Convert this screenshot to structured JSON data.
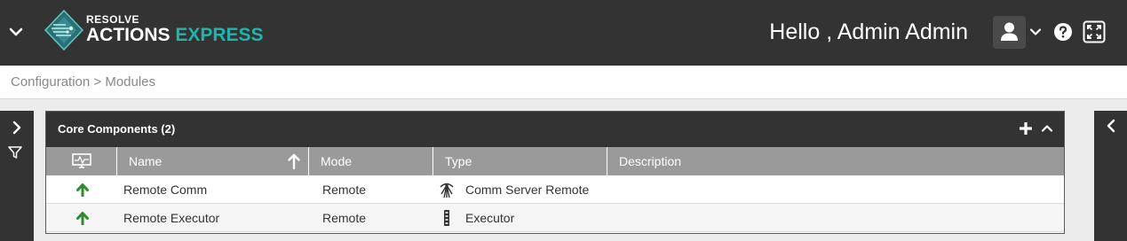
{
  "header": {
    "logo_top": "RESOLVE",
    "logo_word1": "ACTIONS",
    "logo_word2": "EXPRESS",
    "greeting": "Hello , Admin Admin",
    "icons": [
      "chevron-down-icon",
      "user-icon",
      "help-icon",
      "fullscreen-icon"
    ]
  },
  "breadcrumb": "Configuration > Modules",
  "panel": {
    "title": "Core Components (2)",
    "columns": [
      "Name",
      "Mode",
      "Type",
      "Description"
    ],
    "rows": [
      {
        "status": "up-arrow-icon",
        "name": "Remote Comm",
        "mode": "Remote",
        "type_icon": "antenna-icon",
        "type": "Comm Server Remote",
        "description": ""
      },
      {
        "status": "up-arrow-icon",
        "name": "Remote Executor",
        "mode": "Remote",
        "type_icon": "executor-icon",
        "type": "Executor",
        "description": ""
      }
    ]
  },
  "colors": {
    "header_bg": "#333333",
    "accent": "#1fb5ad",
    "status_up": "#2e8b2e",
    "table_header_bg": "#9a9a9a"
  }
}
